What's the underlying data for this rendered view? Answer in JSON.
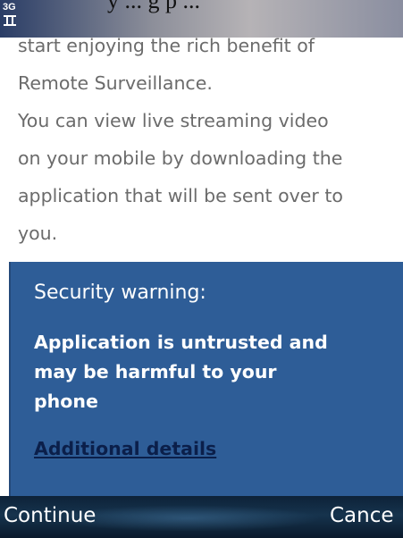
{
  "status_bar": {
    "network_label": "3G",
    "cut_text": "y ... g p ..."
  },
  "body": {
    "lines": [
      "start enjoying the rich benefit of",
      "Remote Surveillance.",
      "You can view live streaming video",
      "on your mobile by downloading the",
      "application that will be sent over to",
      "you."
    ]
  },
  "dialog": {
    "title": "Security warning:",
    "message_lines": [
      "Application is untrusted and",
      "may be harmful to your",
      "phone"
    ],
    "details_link": "Additional details"
  },
  "softkeys": {
    "left": "Continue",
    "right": "Cance"
  },
  "colors": {
    "dialog_background": "#2e5d97",
    "softkey_bar": "#0d2238",
    "body_text": "#6b6b6b",
    "link": "#0b1f4a"
  }
}
